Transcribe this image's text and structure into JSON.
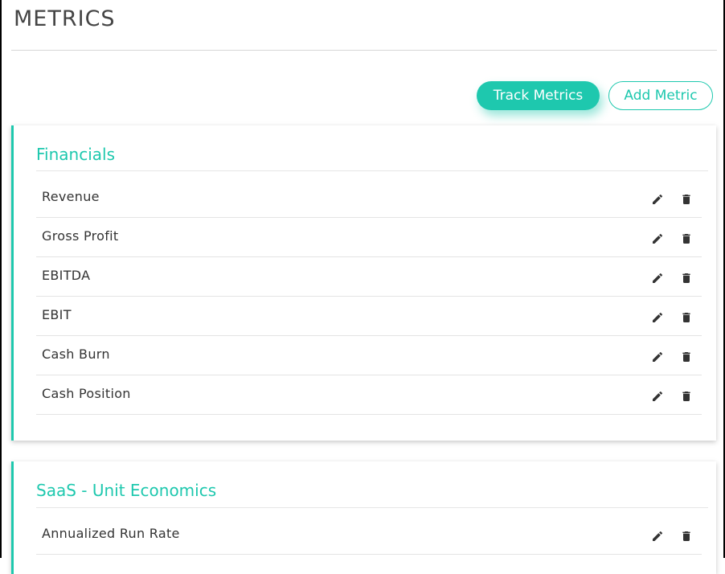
{
  "page": {
    "title": "METRICS"
  },
  "actions": {
    "track_label": "Track Metrics",
    "add_label": "Add Metric"
  },
  "colors": {
    "accent": "#1ec8ae",
    "text": "#333333",
    "icon": "#333333"
  },
  "icons": {
    "edit": "pencil-icon",
    "delete": "trash-icon"
  },
  "groups": [
    {
      "title": "Financials",
      "metrics": [
        "Revenue",
        "Gross Profit",
        "EBITDA",
        "EBIT",
        "Cash Burn",
        "Cash Position"
      ]
    },
    {
      "title": "SaaS - Unit Economics",
      "metrics": [
        "Annualized Run Rate"
      ]
    }
  ]
}
